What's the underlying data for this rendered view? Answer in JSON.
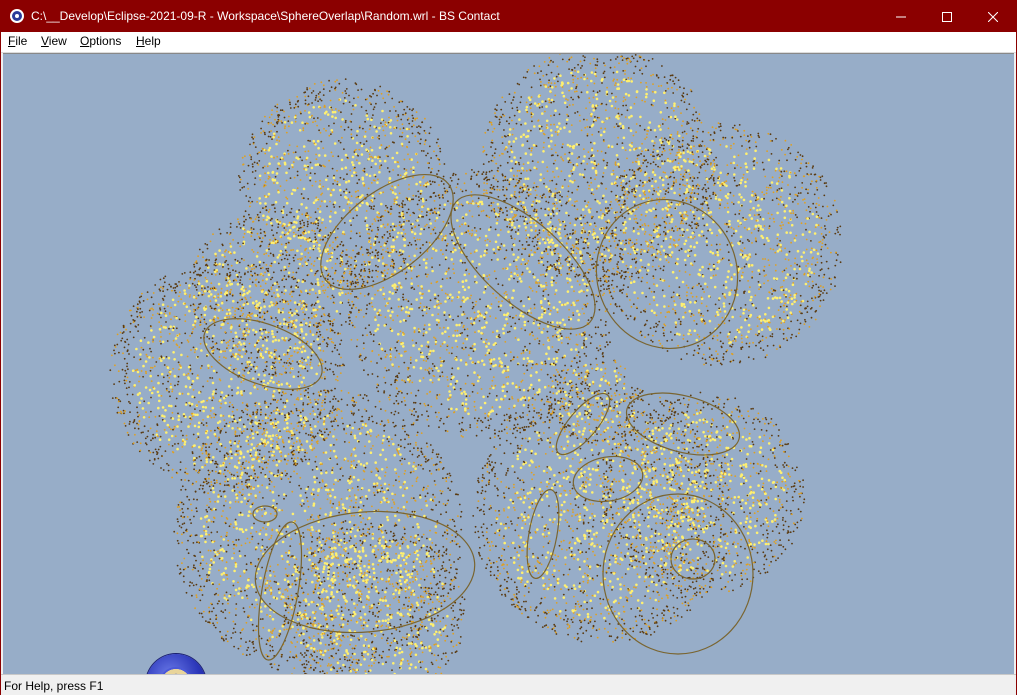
{
  "window": {
    "title": "C:\\__Develop\\Eclipse-2021-09-R - Workspace\\SphereOverlap\\Random.wrl - BS Contact",
    "controls": {
      "minimize_icon": "minimize-icon",
      "maximize_icon": "maximize-icon",
      "close_icon": "close-icon"
    }
  },
  "menu": {
    "file": {
      "mnemonic": "F",
      "rest": "ile"
    },
    "view": {
      "mnemonic": "V",
      "rest": "iew"
    },
    "options": {
      "mnemonic": "O",
      "rest": "ptions"
    },
    "help": {
      "mnemonic": "H",
      "rest": "elp"
    }
  },
  "viewport": {
    "background": "#97adc8",
    "scene": "sphere-overlap-point-cloud"
  },
  "status": {
    "text": "For Help, press F1"
  },
  "colors": {
    "titlebar": "#8b0000",
    "point_bright": "#fff070",
    "point_mid": "#e0a020",
    "point_dark": "#5a3a10",
    "ring": "#7a6530"
  }
}
